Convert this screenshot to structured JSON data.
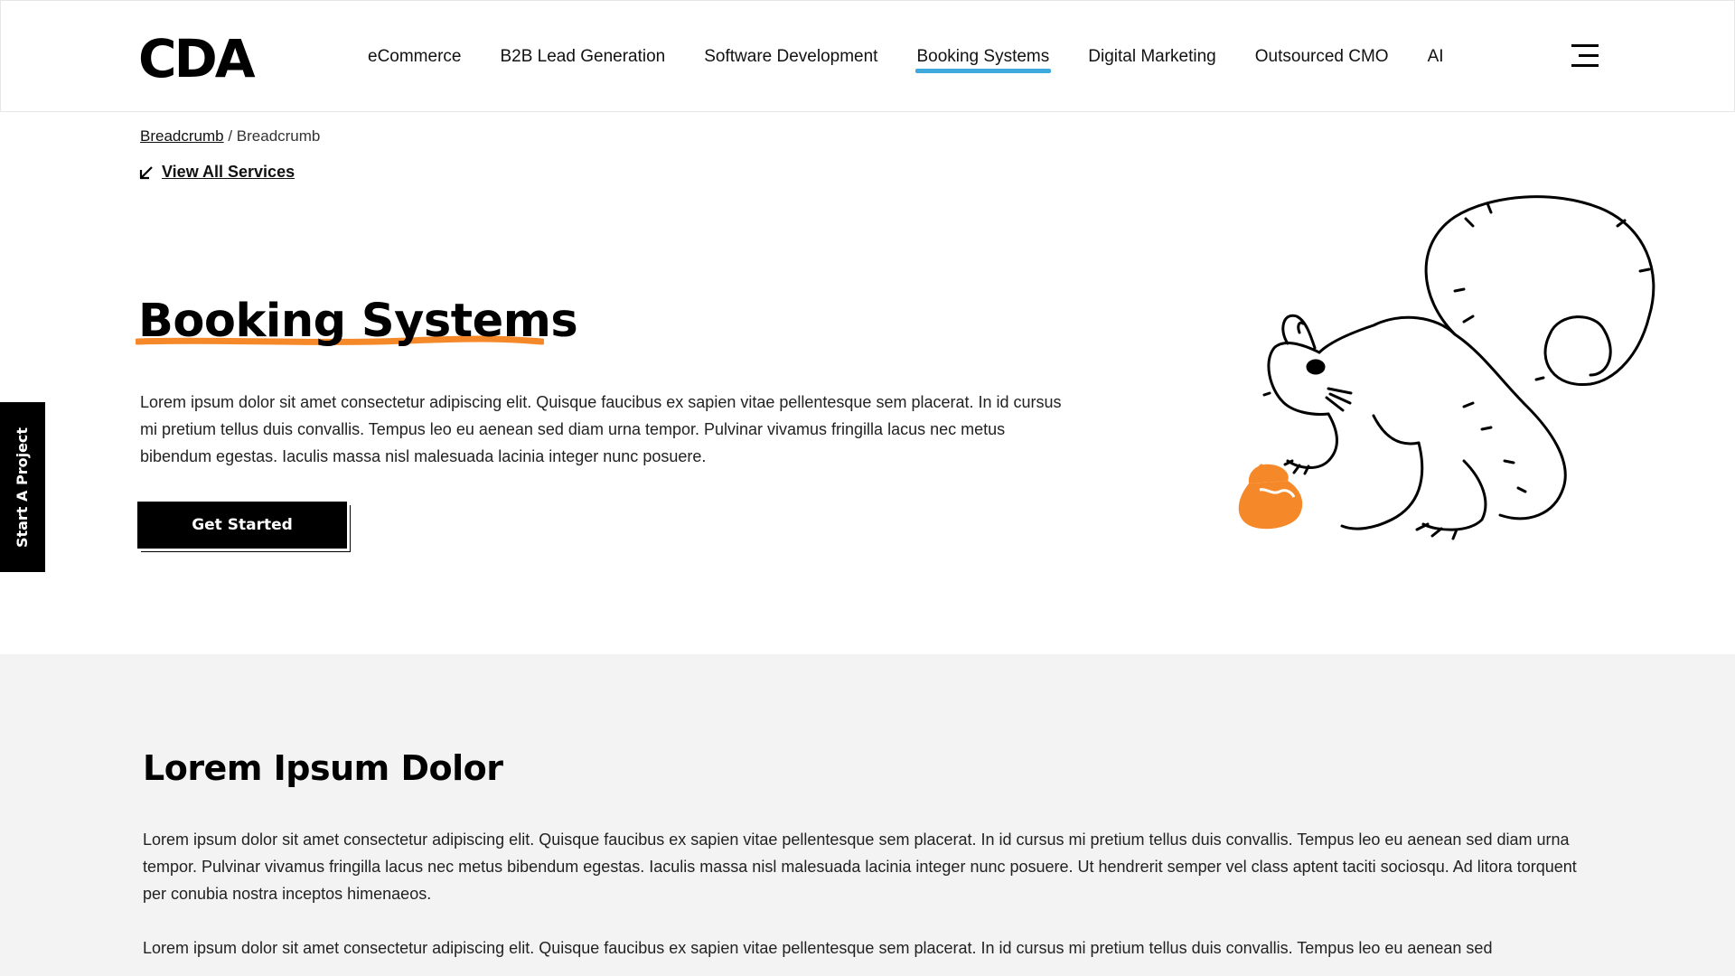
{
  "header": {
    "logo_text": "CDA",
    "nav": [
      {
        "label": "eCommerce",
        "active": false
      },
      {
        "label": "B2B Lead Generation",
        "active": false
      },
      {
        "label": "Software Development",
        "active": false
      },
      {
        "label": "Booking Systems",
        "active": true
      },
      {
        "label": "Digital Marketing",
        "active": false
      },
      {
        "label": "Outsourced CMO",
        "active": false
      },
      {
        "label": "AI",
        "active": false
      }
    ],
    "menu_icon": "hamburger-menu-icon"
  },
  "breadcrumb": {
    "link": "Breadcrumb",
    "separator": " / ",
    "current": "Breadcrumb"
  },
  "view_all": {
    "icon": "arrow-down-left-icon",
    "label": "View All Services"
  },
  "hero": {
    "title": "Booking Systems",
    "text": "Lorem ipsum dolor sit amet consectetur adipiscing elit. Quisque faucibus ex sapien vitae pellentesque sem placerat. In id cursus mi pretium tellus duis convallis. Tempus leo eu aenean sed diam urna tempor. Pulvinar vivamus fringilla lacus nec metus bibendum egestas. Iaculis massa nisl malesuada lacinia integer nunc posuere.",
    "cta_label": "Get Started",
    "illustration": "squirrel-with-acorn-illustration"
  },
  "side_tab": {
    "label": "Start A Project"
  },
  "section": {
    "title": "Lorem Ipsum Dolor",
    "paragraphs": [
      "Lorem ipsum dolor sit amet consectetur adipiscing elit. Quisque faucibus ex sapien vitae pellentesque sem placerat. In id cursus mi pretium tellus duis convallis. Tempus leo eu aenean sed diam urna tempor. Pulvinar vivamus fringilla lacus nec metus bibendum egestas. Iaculis massa nisl malesuada lacinia integer nunc posuere. Ut hendrerit semper vel class aptent taciti sociosqu. Ad litora torquent per conubia nostra inceptos himenaeos.",
      "Lorem ipsum dolor sit amet consectetur adipiscing elit. Quisque faucibus ex sapien vitae pellentesque sem placerat. In id cursus mi pretium tellus duis convallis. Tempus leo eu aenean sed"
    ]
  },
  "colors": {
    "accent_orange": "#f5892a",
    "nav_active_underline": "#3fa9dd",
    "section_background": "#f3f3f3",
    "button_background": "#000000"
  }
}
